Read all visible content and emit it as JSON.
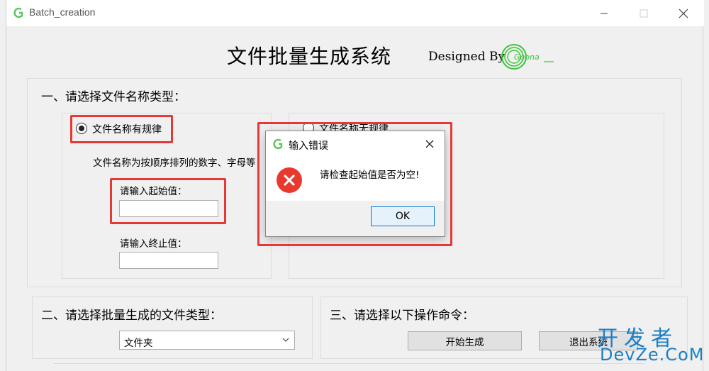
{
  "window": {
    "title": "Batch_creation",
    "controls": {
      "minimize": "—",
      "maximize": "☐",
      "close": "✕"
    }
  },
  "header": {
    "system_title": "文件批量生成系统",
    "designed_by": "Designed By",
    "logo_text": "Goona"
  },
  "section1": {
    "title": "一、请选择文件名称类型：",
    "option_regular": "文件名称有规律",
    "option_irregular": "文件名称无规律",
    "description": "文件名称为按顺序排列的数字、字母等",
    "start_label": "请输入起始值：",
    "start_value": "",
    "end_label": "请输入终止值：",
    "end_value": ""
  },
  "section2": {
    "title": "二、请选择批量生成的文件类型：",
    "selected_type": "文件夹"
  },
  "section3": {
    "title": "三、请选择以下操作命令：",
    "start_button": "开始生成",
    "exit_button": "退出系统"
  },
  "dialog": {
    "title": "输入错误",
    "message": "请检查起始值是否为空!",
    "ok_label": "OK"
  },
  "watermark": {
    "cn": "开发者",
    "en": "DevZe.CoM"
  },
  "colors": {
    "highlight": "#e53935",
    "accent": "#0078d7",
    "logo_green": "#3cc43c",
    "watermark": "#1a7fc4"
  }
}
